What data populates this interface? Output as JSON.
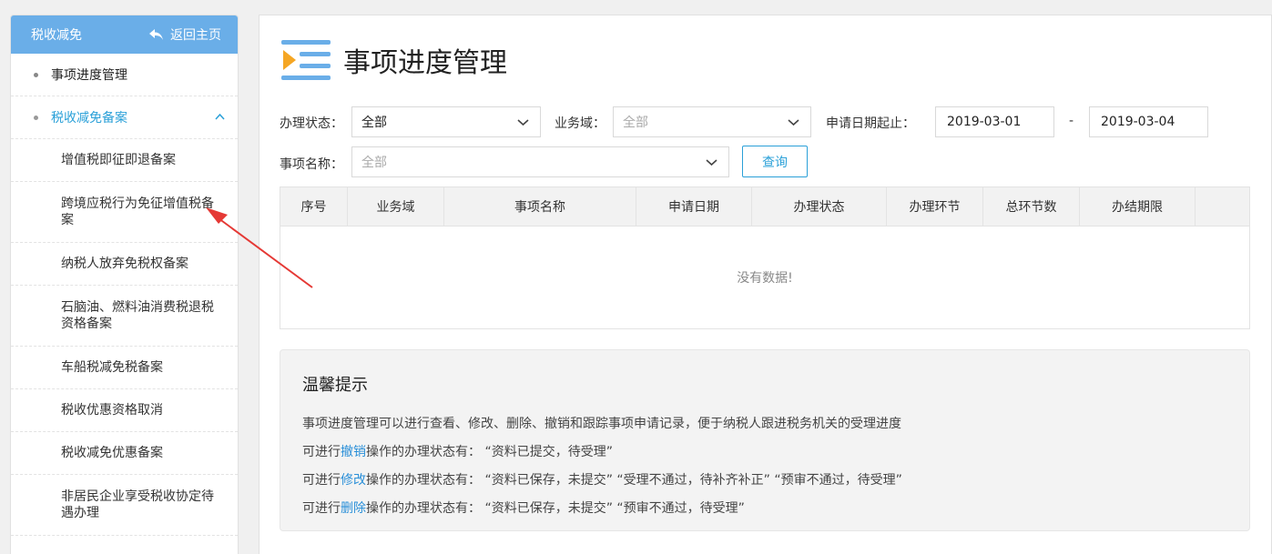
{
  "sidebar": {
    "title": "税收减免",
    "back_label": "返回主页",
    "items": [
      {
        "label": "事项进度管理"
      },
      {
        "label": "税收减免备案"
      }
    ],
    "subitems": [
      {
        "label": "增值税即征即退备案"
      },
      {
        "label": "跨境应税行为免征增值税备案"
      },
      {
        "label": "纳税人放弃免税权备案"
      },
      {
        "label": "石脑油、燃料油消费税退税资格备案"
      },
      {
        "label": "车船税减免税备案"
      },
      {
        "label": "税收优惠资格取消"
      },
      {
        "label": "税收减免优惠备案"
      },
      {
        "label": "非居民企业享受税收协定待遇办理"
      }
    ]
  },
  "main": {
    "title": "事项进度管理",
    "filters": {
      "status_label": "办理状态：",
      "status_value": "全部",
      "domain_label": "业务域：",
      "domain_value": "全部",
      "date_label": "申请日期起止：",
      "date_start": "2019-03-01",
      "date_sep": "-",
      "date_end": "2019-03-04",
      "item_label": "事项名称：",
      "item_value": "全部",
      "query_button": "查询"
    },
    "table": {
      "columns": [
        "序号",
        "业务域",
        "事项名称",
        "申请日期",
        "办理状态",
        "办理环节",
        "总环节数",
        "办结期限"
      ],
      "empty_text": "没有数据!"
    },
    "tips": {
      "title": "温馨提示",
      "line1": "事项进度管理可以进行查看、修改、删除、撤销和跟踪事项申请记录，便于纳税人跟进税务机关的受理进度",
      "line2_prefix": "可进行",
      "line2_link": "撤销",
      "line2_suffix": "操作的办理状态有：  “资料已提交，待受理”",
      "line3_prefix": "可进行",
      "line3_link": "修改",
      "line3_suffix": "操作的办理状态有：  “资料已保存，未提交”   “受理不通过，待补齐补正”   “预审不通过，待受理”",
      "line4_prefix": "可进行",
      "line4_link": "删除",
      "line4_suffix": "操作的办理状态有：  “资料已保存，未提交”   “预审不通过，待受理”"
    }
  },
  "colors": {
    "sidebar_header": "#6aaee8",
    "accent": "#2aa0d8",
    "annotation_arrow": "#e53935"
  }
}
